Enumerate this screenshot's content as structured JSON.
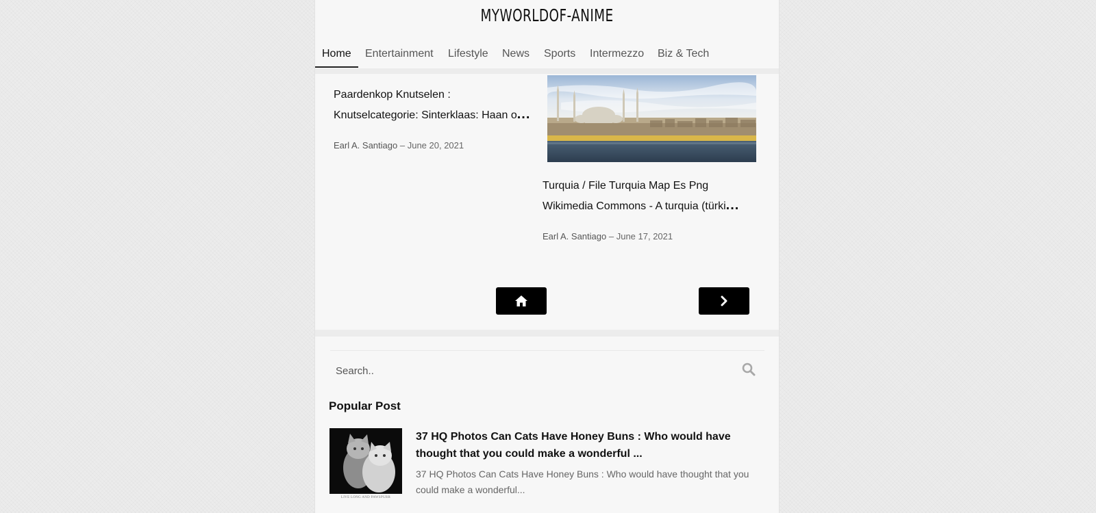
{
  "site": {
    "title": "MYWORLDOF-ANIME"
  },
  "nav": {
    "items": [
      {
        "label": "Home",
        "active": true
      },
      {
        "label": "Entertainment"
      },
      {
        "label": "Lifestyle"
      },
      {
        "label": "News"
      },
      {
        "label": "Sports"
      },
      {
        "label": "Intermezzo"
      },
      {
        "label": "Biz & Tech"
      }
    ]
  },
  "posts": [
    {
      "title_line1": "Paardenkop Knutselen :",
      "title_line2": "Knutselcategorie: Sinterklaas: Haan o",
      "ellipsis": "...",
      "author": "Earl A. Santiago",
      "date_sep": "–",
      "date": "June 20, 2021"
    },
    {
      "title_line1": "Turquia / File Turquia Map Es Png",
      "title_line2": "Wikimedia Commons - A turquia (türki",
      "ellipsis": "...",
      "author": "Earl A. Santiago",
      "date_sep": "–",
      "date": "June 17, 2021"
    }
  ],
  "pager": {
    "home_icon": "home-icon",
    "next_icon": "chevron-right-icon"
  },
  "search": {
    "placeholder": "Search..",
    "icon": "search-icon"
  },
  "popular": {
    "heading": "Popular Post",
    "items": [
      {
        "title": "37 HQ Photos Can Cats Have Honey Buns : Who would have thought that you could make a wonderful ...",
        "excerpt": "37 HQ Photos Can Cats Have Honey Buns : Who would have thought that you could make a wonderful...",
        "thumb_caption": "LIVE LONG AND PAWSPURR"
      }
    ]
  },
  "colors": {
    "page_bg": "#f7f7f7",
    "body_bg": "#ececec",
    "button_bg": "#000000",
    "text": "#111111",
    "meta": "#666666"
  }
}
